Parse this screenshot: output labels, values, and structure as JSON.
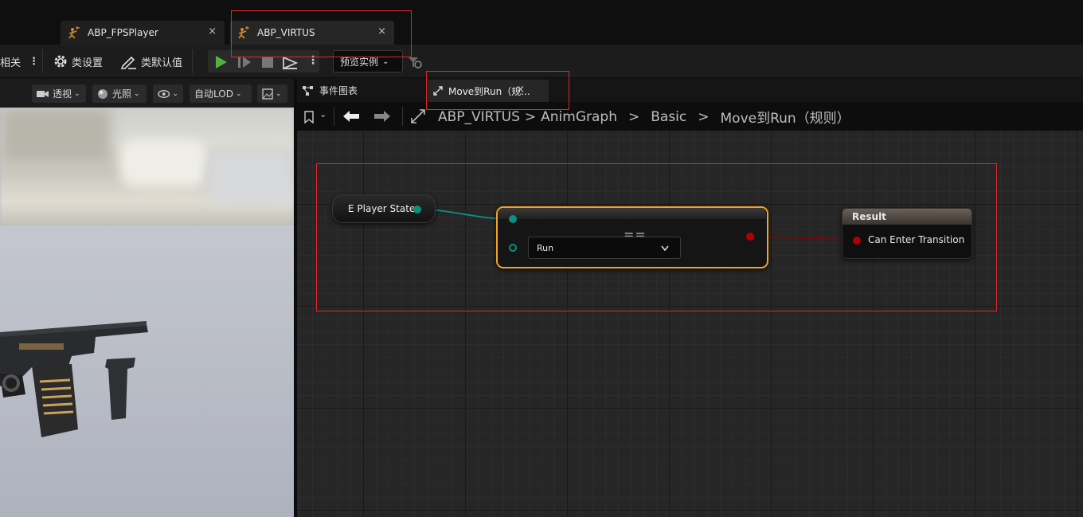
{
  "tabs": [
    {
      "label": "ABP_FPSPlayer",
      "close": "×"
    },
    {
      "label": "ABP_VIRTUS",
      "close": "×"
    }
  ],
  "toolbar": {
    "left_label": "相关",
    "class_settings": "类设置",
    "class_defaults": "类默认值",
    "preview_instance": "预览实例"
  },
  "viewport_toolbar": {
    "perspective": "透视",
    "lighting": "光照",
    "lod": "自动LOD"
  },
  "graph_tabs": {
    "event_graph": "事件图表",
    "rule_tab": "Move到Run（规...",
    "rule_close": "×"
  },
  "breadcrumb": {
    "items": [
      "ABP_VIRTUS",
      "AnimGraph",
      "Basic",
      "Move到Run（规则）"
    ],
    "separator": ">"
  },
  "nodes": {
    "player_state": {
      "label": "E Player State"
    },
    "equal": {
      "title": "==",
      "dropdown_value": "Run"
    },
    "result": {
      "title": "Result",
      "pin_label": "Can Enter Transition"
    }
  },
  "colors": {
    "enum_pin": "#0c8f82",
    "bool_pin": "#8c0000",
    "selected_outline": "#f0a423",
    "highlight": "#e3262b",
    "play_green": "#4fb53a"
  }
}
